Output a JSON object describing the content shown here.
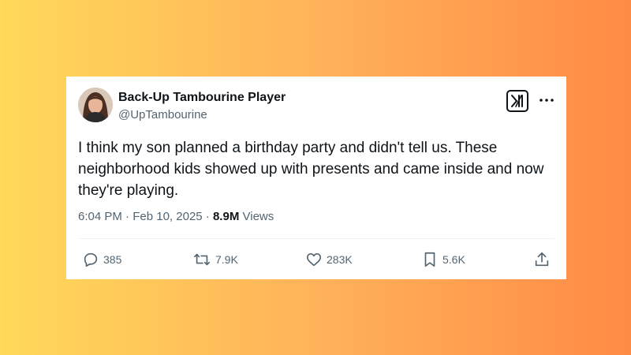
{
  "account": {
    "display_name": "Back-Up Tambourine Player",
    "handle": "@UpTambourine"
  },
  "tweet": {
    "text": "I think my son planned a birthday party and didn't tell us. These neighborhood kids showed up with presents and came inside and now they're playing.",
    "time": "6:04 PM",
    "separator1": "·",
    "date": "Feb 10, 2025",
    "separator2": "·",
    "views_count": "8.9M",
    "views_label": "Views"
  },
  "actions": {
    "replies": "385",
    "reposts": "7.9K",
    "likes": "283K",
    "bookmarks": "5.6K"
  },
  "icons": [
    "avatar",
    "x-logo-icon",
    "more-options-icon",
    "reply-icon",
    "repost-icon",
    "like-icon",
    "bookmark-icon",
    "share-icon"
  ],
  "colors": {
    "text_primary": "#0f1419",
    "text_secondary": "#536471",
    "background_gradient_start": "#ffd95a",
    "background_gradient_end": "#ff8a45"
  }
}
